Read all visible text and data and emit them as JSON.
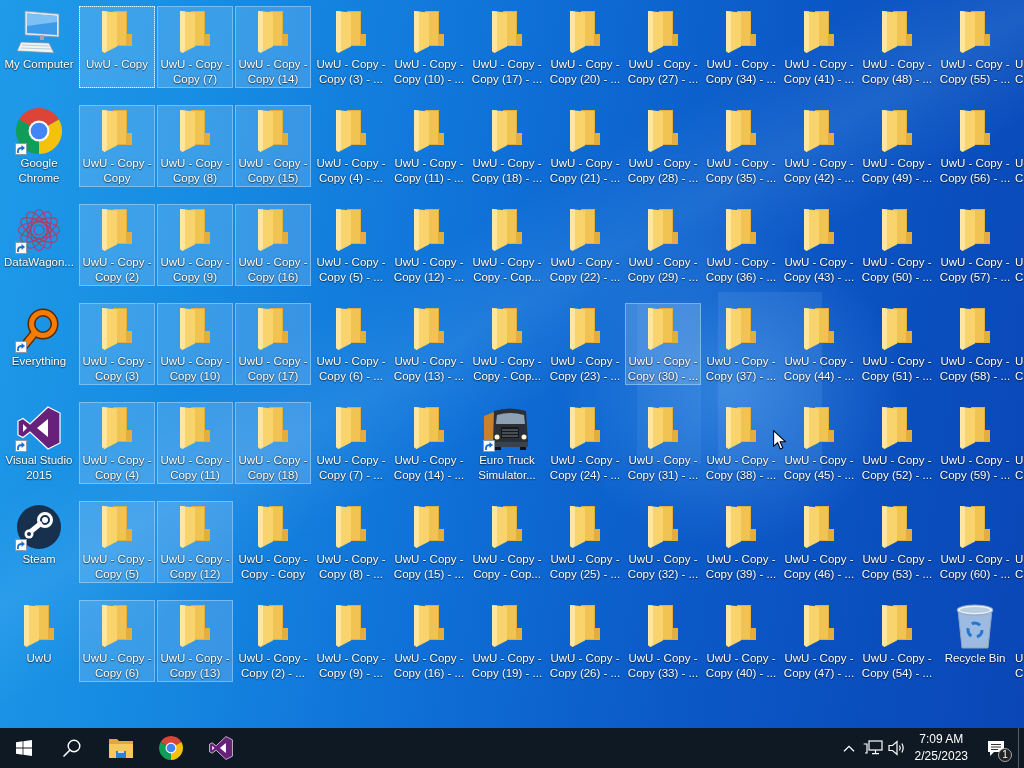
{
  "desktop": {
    "icons": [
      {
        "label": "My Computer",
        "kind": "computer",
        "shortcut": false,
        "selected": false,
        "focused": false
      },
      {
        "label": "UwU - Copy",
        "kind": "folder",
        "shortcut": false,
        "selected": true,
        "focused": true
      },
      {
        "label": "UwU - Copy - Copy (7)",
        "kind": "folder",
        "shortcut": false,
        "selected": true,
        "focused": false
      },
      {
        "label": "UwU - Copy - Copy (14)",
        "kind": "folder",
        "shortcut": false,
        "selected": true,
        "focused": false
      },
      {
        "label": "UwU - Copy - Copy (3) - ...",
        "kind": "folder",
        "shortcut": false,
        "selected": false,
        "focused": false
      },
      {
        "label": "UwU - Copy - Copy (10) - ...",
        "kind": "folder",
        "shortcut": false,
        "selected": false,
        "focused": false
      },
      {
        "label": "UwU - Copy - Copy (17) - ...",
        "kind": "folder",
        "shortcut": false,
        "selected": false,
        "focused": false
      },
      {
        "label": "UwU - Copy - Copy (20) - ...",
        "kind": "folder",
        "shortcut": false,
        "selected": false,
        "focused": false
      },
      {
        "label": "UwU - Copy - Copy (27) - ...",
        "kind": "folder",
        "shortcut": false,
        "selected": false,
        "focused": false
      },
      {
        "label": "UwU - Copy - Copy (34) - ...",
        "kind": "folder",
        "shortcut": false,
        "selected": false,
        "focused": false
      },
      {
        "label": "UwU - Copy - Copy (41) - ...",
        "kind": "folder",
        "shortcut": false,
        "selected": false,
        "focused": false
      },
      {
        "label": "UwU - Copy - Copy (48) - ...",
        "kind": "folder",
        "shortcut": false,
        "selected": false,
        "focused": false
      },
      {
        "label": "UwU - Copy - Copy (55) - ...",
        "kind": "folder",
        "shortcut": false,
        "selected": false,
        "focused": false
      },
      {
        "label": "U C",
        "kind": "cut",
        "shortcut": false,
        "selected": false,
        "focused": false
      },
      {
        "label": "Google Chrome",
        "kind": "chrome",
        "shortcut": true,
        "selected": false,
        "focused": false
      },
      {
        "label": "UwU - Copy - Copy",
        "kind": "folder",
        "shortcut": false,
        "selected": true,
        "focused": false
      },
      {
        "label": "UwU - Copy - Copy (8)",
        "kind": "folder",
        "shortcut": false,
        "selected": true,
        "focused": false
      },
      {
        "label": "UwU - Copy - Copy (15)",
        "kind": "folder",
        "shortcut": false,
        "selected": true,
        "focused": false
      },
      {
        "label": "UwU - Copy - Copy (4) - ...",
        "kind": "folder",
        "shortcut": false,
        "selected": false,
        "focused": false
      },
      {
        "label": "UwU - Copy - Copy (11) - ...",
        "kind": "folder",
        "shortcut": false,
        "selected": false,
        "focused": false
      },
      {
        "label": "UwU - Copy - Copy (18) - ...",
        "kind": "folder",
        "shortcut": false,
        "selected": false,
        "focused": false
      },
      {
        "label": "UwU - Copy - Copy (21) - ...",
        "kind": "folder",
        "shortcut": false,
        "selected": false,
        "focused": false
      },
      {
        "label": "UwU - Copy - Copy (28) - ...",
        "kind": "folder",
        "shortcut": false,
        "selected": false,
        "focused": false
      },
      {
        "label": "UwU - Copy - Copy (35) - ...",
        "kind": "folder",
        "shortcut": false,
        "selected": false,
        "focused": false
      },
      {
        "label": "UwU - Copy - Copy (42) - ...",
        "kind": "folder",
        "shortcut": false,
        "selected": false,
        "focused": false
      },
      {
        "label": "UwU - Copy - Copy (49) - ...",
        "kind": "folder",
        "shortcut": false,
        "selected": false,
        "focused": false
      },
      {
        "label": "UwU - Copy - Copy (56) - ...",
        "kind": "folder",
        "shortcut": false,
        "selected": false,
        "focused": false
      },
      {
        "label": "U C",
        "kind": "cut",
        "shortcut": false,
        "selected": false,
        "focused": false
      },
      {
        "label": "DataWagon...",
        "kind": "datawagon",
        "shortcut": true,
        "selected": false,
        "focused": false
      },
      {
        "label": "UwU - Copy - Copy (2)",
        "kind": "folder",
        "shortcut": false,
        "selected": true,
        "focused": false
      },
      {
        "label": "UwU - Copy - Copy (9)",
        "kind": "folder",
        "shortcut": false,
        "selected": true,
        "focused": false
      },
      {
        "label": "UwU - Copy - Copy (16)",
        "kind": "folder",
        "shortcut": false,
        "selected": true,
        "focused": false
      },
      {
        "label": "UwU - Copy - Copy (5) - ...",
        "kind": "folder",
        "shortcut": false,
        "selected": false,
        "focused": false
      },
      {
        "label": "UwU - Copy - Copy (12) - ...",
        "kind": "folder",
        "shortcut": false,
        "selected": false,
        "focused": false
      },
      {
        "label": "UwU - Copy - Copy - Cop...",
        "kind": "folder",
        "shortcut": false,
        "selected": false,
        "focused": false
      },
      {
        "label": "UwU - Copy - Copy (22) - ...",
        "kind": "folder",
        "shortcut": false,
        "selected": false,
        "focused": false
      },
      {
        "label": "UwU - Copy - Copy (29) - ...",
        "kind": "folder",
        "shortcut": false,
        "selected": false,
        "focused": false
      },
      {
        "label": "UwU - Copy - Copy (36) - ...",
        "kind": "folder",
        "shortcut": false,
        "selected": false,
        "focused": false
      },
      {
        "label": "UwU - Copy - Copy (43) - ...",
        "kind": "folder",
        "shortcut": false,
        "selected": false,
        "focused": false
      },
      {
        "label": "UwU - Copy - Copy (50) - ...",
        "kind": "folder",
        "shortcut": false,
        "selected": false,
        "focused": false
      },
      {
        "label": "UwU - Copy - Copy (57) - ...",
        "kind": "folder",
        "shortcut": false,
        "selected": false,
        "focused": false
      },
      {
        "label": "U C",
        "kind": "cut",
        "shortcut": false,
        "selected": false,
        "focused": false
      },
      {
        "label": "Everything",
        "kind": "everything",
        "shortcut": true,
        "selected": false,
        "focused": false
      },
      {
        "label": "UwU - Copy - Copy (3)",
        "kind": "folder",
        "shortcut": false,
        "selected": true,
        "focused": false
      },
      {
        "label": "UwU - Copy - Copy (10)",
        "kind": "folder",
        "shortcut": false,
        "selected": true,
        "focused": false
      },
      {
        "label": "UwU - Copy - Copy (17)",
        "kind": "folder",
        "shortcut": false,
        "selected": true,
        "focused": false
      },
      {
        "label": "UwU - Copy - Copy (6) - ...",
        "kind": "folder",
        "shortcut": false,
        "selected": false,
        "focused": false
      },
      {
        "label": "UwU - Copy - Copy (13) - ...",
        "kind": "folder",
        "shortcut": false,
        "selected": false,
        "focused": false
      },
      {
        "label": "UwU - Copy - Copy - Cop...",
        "kind": "folder",
        "shortcut": false,
        "selected": false,
        "focused": false
      },
      {
        "label": "UwU - Copy - Copy (23) - ...",
        "kind": "folder",
        "shortcut": false,
        "selected": false,
        "focused": false
      },
      {
        "label": "UwU - Copy - Copy (30) - ...",
        "kind": "folder",
        "shortcut": false,
        "selected": true,
        "focused": false
      },
      {
        "label": "UwU - Copy - Copy (37) - ...",
        "kind": "folder",
        "shortcut": false,
        "selected": false,
        "focused": false
      },
      {
        "label": "UwU - Copy - Copy (44) - ...",
        "kind": "folder",
        "shortcut": false,
        "selected": false,
        "focused": false
      },
      {
        "label": "UwU - Copy - Copy (51) - ...",
        "kind": "folder",
        "shortcut": false,
        "selected": false,
        "focused": false
      },
      {
        "label": "UwU - Copy - Copy (58) - ...",
        "kind": "folder",
        "shortcut": false,
        "selected": false,
        "focused": false
      },
      {
        "label": "U C",
        "kind": "cut",
        "shortcut": false,
        "selected": false,
        "focused": false
      },
      {
        "label": "Visual Studio 2015",
        "kind": "visualstudio",
        "shortcut": true,
        "selected": false,
        "focused": false
      },
      {
        "label": "UwU - Copy - Copy (4)",
        "kind": "folder",
        "shortcut": false,
        "selected": true,
        "focused": false
      },
      {
        "label": "UwU - Copy - Copy (11)",
        "kind": "folder",
        "shortcut": false,
        "selected": true,
        "focused": false
      },
      {
        "label": "UwU - Copy - Copy (18)",
        "kind": "folder",
        "shortcut": false,
        "selected": true,
        "focused": false
      },
      {
        "label": "UwU - Copy - Copy (7) - ...",
        "kind": "folder",
        "shortcut": false,
        "selected": false,
        "focused": false
      },
      {
        "label": "UwU - Copy - Copy (14) - ...",
        "kind": "folder",
        "shortcut": false,
        "selected": false,
        "focused": false
      },
      {
        "label": "Euro Truck Simulator...",
        "kind": "truck",
        "shortcut": true,
        "selected": false,
        "focused": false
      },
      {
        "label": "UwU - Copy - Copy (24) - ...",
        "kind": "folder",
        "shortcut": false,
        "selected": false,
        "focused": false
      },
      {
        "label": "UwU - Copy - Copy (31) - ...",
        "kind": "folder",
        "shortcut": false,
        "selected": false,
        "focused": false
      },
      {
        "label": "UwU - Copy - Copy (38) - ...",
        "kind": "folder",
        "shortcut": false,
        "selected": false,
        "focused": false
      },
      {
        "label": "UwU - Copy - Copy (45) - ...",
        "kind": "folder",
        "shortcut": false,
        "selected": false,
        "focused": false
      },
      {
        "label": "UwU - Copy - Copy (52) - ...",
        "kind": "folder",
        "shortcut": false,
        "selected": false,
        "focused": false
      },
      {
        "label": "UwU - Copy - Copy (59) - ...",
        "kind": "folder",
        "shortcut": false,
        "selected": false,
        "focused": false
      },
      {
        "label": "U C",
        "kind": "cut",
        "shortcut": false,
        "selected": false,
        "focused": false
      },
      {
        "label": "Steam",
        "kind": "steam",
        "shortcut": true,
        "selected": false,
        "focused": false
      },
      {
        "label": "UwU - Copy - Copy (5)",
        "kind": "folder",
        "shortcut": false,
        "selected": true,
        "focused": false
      },
      {
        "label": "UwU - Copy - Copy (12)",
        "kind": "folder",
        "shortcut": false,
        "selected": true,
        "focused": false
      },
      {
        "label": "UwU - Copy - Copy - Copy",
        "kind": "folder",
        "shortcut": false,
        "selected": false,
        "focused": false
      },
      {
        "label": "UwU - Copy - Copy (8) - ...",
        "kind": "folder",
        "shortcut": false,
        "selected": false,
        "focused": false
      },
      {
        "label": "UwU - Copy - Copy (15) - ...",
        "kind": "folder",
        "shortcut": false,
        "selected": false,
        "focused": false
      },
      {
        "label": "UwU - Copy - Copy - Cop...",
        "kind": "folder",
        "shortcut": false,
        "selected": false,
        "focused": false
      },
      {
        "label": "UwU - Copy - Copy (25) - ...",
        "kind": "folder",
        "shortcut": false,
        "selected": false,
        "focused": false
      },
      {
        "label": "UwU - Copy - Copy (32) - ...",
        "kind": "folder",
        "shortcut": false,
        "selected": false,
        "focused": false
      },
      {
        "label": "UwU - Copy - Copy (39) - ...",
        "kind": "folder",
        "shortcut": false,
        "selected": false,
        "focused": false
      },
      {
        "label": "UwU - Copy - Copy (46) - ...",
        "kind": "folder",
        "shortcut": false,
        "selected": false,
        "focused": false
      },
      {
        "label": "UwU - Copy - Copy (53) - ...",
        "kind": "folder",
        "shortcut": false,
        "selected": false,
        "focused": false
      },
      {
        "label": "UwU - Copy - Copy (60) - ...",
        "kind": "folder",
        "shortcut": false,
        "selected": false,
        "focused": false
      },
      {
        "label": "U C",
        "kind": "cut",
        "shortcut": false,
        "selected": false,
        "focused": false
      },
      {
        "label": "UwU",
        "kind": "folder",
        "shortcut": false,
        "selected": false,
        "focused": false
      },
      {
        "label": "UwU - Copy - Copy (6)",
        "kind": "folder",
        "shortcut": false,
        "selected": true,
        "focused": false
      },
      {
        "label": "UwU - Copy - Copy (13)",
        "kind": "folder",
        "shortcut": false,
        "selected": true,
        "focused": false
      },
      {
        "label": "UwU - Copy - Copy (2) - ...",
        "kind": "folder",
        "shortcut": false,
        "selected": false,
        "focused": false
      },
      {
        "label": "UwU - Copy - Copy (9) - ...",
        "kind": "folder",
        "shortcut": false,
        "selected": false,
        "focused": false
      },
      {
        "label": "UwU - Copy - Copy (16) - ...",
        "kind": "folder",
        "shortcut": false,
        "selected": false,
        "focused": false
      },
      {
        "label": "UwU - Copy - Copy (19) - ...",
        "kind": "folder",
        "shortcut": false,
        "selected": false,
        "focused": false
      },
      {
        "label": "UwU - Copy - Copy (26) - ...",
        "kind": "folder",
        "shortcut": false,
        "selected": false,
        "focused": false
      },
      {
        "label": "UwU - Copy - Copy (33) - ...",
        "kind": "folder",
        "shortcut": false,
        "selected": false,
        "focused": false
      },
      {
        "label": "UwU - Copy - Copy (40) - ...",
        "kind": "folder",
        "shortcut": false,
        "selected": false,
        "focused": false
      },
      {
        "label": "UwU - Copy - Copy (47) - ...",
        "kind": "folder",
        "shortcut": false,
        "selected": false,
        "focused": false
      },
      {
        "label": "UwU - Copy - Copy (54) - ...",
        "kind": "folder",
        "shortcut": false,
        "selected": false,
        "focused": false
      },
      {
        "label": "Recycle Bin",
        "kind": "recyclebin",
        "shortcut": false,
        "selected": false,
        "focused": false
      },
      {
        "label": "U C",
        "kind": "cut",
        "shortcut": false,
        "selected": false,
        "focused": false
      }
    ]
  },
  "taskbar": {
    "buttons": [
      {
        "kind": "start"
      },
      {
        "kind": "search"
      },
      {
        "kind": "explorer"
      },
      {
        "kind": "chrome"
      },
      {
        "kind": "visualstudio"
      }
    ],
    "tray": {
      "icons": [
        {
          "kind": "caret"
        },
        {
          "kind": "network"
        },
        {
          "kind": "volume"
        }
      ],
      "time": "7:09 AM",
      "date": "2/25/2023",
      "notification_count": "1"
    }
  }
}
